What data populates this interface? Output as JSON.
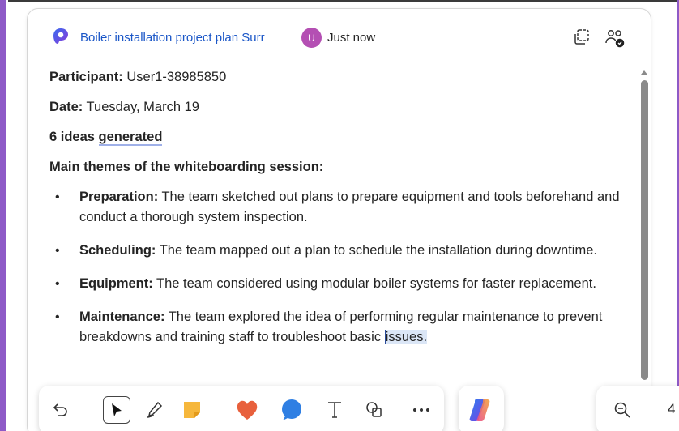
{
  "card": {
    "title": "Boiler installation project plan Surr",
    "author_initial": "U",
    "timestamp": "Just now"
  },
  "summary": {
    "participant_label": "Participant:",
    "participant_value": " User1-38985850",
    "date_label": "Date:",
    "date_value": " Tuesday, March 19",
    "ideas_count": "6 ideas ",
    "ideas_word": "generated",
    "themes_heading": "Main themes of the whiteboarding session:",
    "themes": [
      {
        "label": "Preparation:",
        "text": " The team sketched out plans to prepare equipment and tools beforehand and conduct a thorough system inspection."
      },
      {
        "label": "Scheduling:",
        "text": " The team mapped out a plan to schedule the installation during downtime."
      },
      {
        "label": "Equipment:",
        "text": " The team considered using modular boiler systems for faster replacement."
      },
      {
        "label": "Maintenance:",
        "text_before": " The team explored the idea of performing regular maintenance to prevent breakdowns and training staff to troubleshoot basic",
        "text_highlight": "issues."
      }
    ]
  },
  "toolbar": {
    "tools": [
      "undo-icon",
      "select-icon",
      "pen-icon",
      "sticky-note-icon",
      "reaction-heart-icon",
      "comment-icon",
      "text-icon",
      "shapes-icon",
      "more-icon"
    ],
    "copilot": "copilot-icon",
    "zoom_level": "4"
  },
  "colors": {
    "accent": "#1a56c7",
    "frame": "#8e5ac7",
    "avatar": "#b44fb3",
    "sticky": "#f6b73c",
    "heart": "#e8603c",
    "comment": "#2f7fe3"
  }
}
